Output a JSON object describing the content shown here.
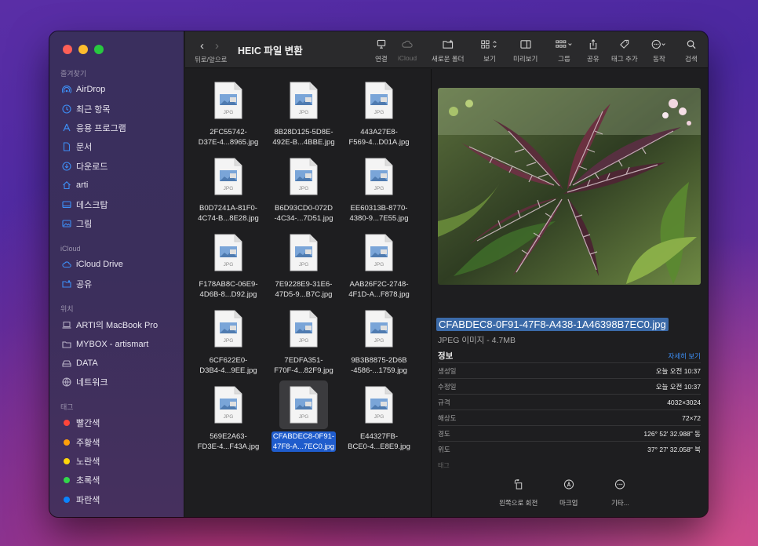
{
  "window": {
    "title": "HEIC 파일 변환",
    "back_label": "뒤로/앞으로"
  },
  "toolbar": {
    "buttons": [
      {
        "label": "연결",
        "icon": "monitor-icon"
      },
      {
        "label": "iCloud",
        "icon": "icloud-icon",
        "disabled": true
      },
      {
        "label": "새로운 폴더",
        "icon": "new-folder-icon"
      },
      {
        "label": "보기",
        "icon": "grid-view-icon"
      },
      {
        "label": "미리보기",
        "icon": "preview-pane-icon"
      },
      {
        "label": "그룹",
        "icon": "group-icon"
      },
      {
        "label": "공유",
        "icon": "share-icon"
      },
      {
        "label": "태그 추가",
        "icon": "tag-icon"
      },
      {
        "label": "동작",
        "icon": "action-icon"
      },
      {
        "label": "검색",
        "icon": "search-icon"
      }
    ]
  },
  "sidebar": {
    "favorites_heading": "즐겨찾기",
    "favorites": [
      {
        "label": "AirDrop",
        "icon": "airdrop-icon"
      },
      {
        "label": "최근 항목",
        "icon": "clock-icon"
      },
      {
        "label": "응용 프로그램",
        "icon": "applications-icon"
      },
      {
        "label": "문서",
        "icon": "document-icon"
      },
      {
        "label": "다운로드",
        "icon": "download-icon"
      },
      {
        "label": "arti",
        "icon": "home-icon"
      },
      {
        "label": "데스크탑",
        "icon": "desktop-icon"
      },
      {
        "label": "그림",
        "icon": "pictures-icon"
      }
    ],
    "icloud_heading": "iCloud",
    "icloud": [
      {
        "label": "iCloud Drive",
        "icon": "icloud-icon"
      },
      {
        "label": "공유",
        "icon": "shared-folder-icon"
      }
    ],
    "locations_heading": "위치",
    "locations": [
      {
        "label": "ARTI의 MacBook Pro",
        "icon": "laptop-icon"
      },
      {
        "label": "MYBOX - artismart",
        "icon": "folder-icon"
      },
      {
        "label": "DATA",
        "icon": "drive-icon"
      },
      {
        "label": "네트워크",
        "icon": "network-icon"
      }
    ],
    "tags_heading": "태그",
    "tags": [
      {
        "label": "빨간색",
        "color": "#ff453a"
      },
      {
        "label": "주황색",
        "color": "#ff9f0a"
      },
      {
        "label": "노란색",
        "color": "#ffd60a"
      },
      {
        "label": "초록색",
        "color": "#32d74b"
      },
      {
        "label": "파란색",
        "color": "#0a84ff"
      }
    ]
  },
  "files": [
    {
      "line1": "2FC55742-",
      "line2": "D37E-4...8965.jpg"
    },
    {
      "line1": "8B28D125-5D8E-",
      "line2": "492E-B...4BBE.jpg"
    },
    {
      "line1": "443A27E8-",
      "line2": "F569-4...D01A.jpg"
    },
    {
      "line1": "B0D7241A-81F0-",
      "line2": "4C74-B...8E28.jpg"
    },
    {
      "line1": "B6D93CD0-072D",
      "line2": "-4C34-...7D51.jpg"
    },
    {
      "line1": "EE60313B-8770-",
      "line2": "4380-9...7E55.jpg"
    },
    {
      "line1": "F178AB8C-06E9-",
      "line2": "4D6B-8...D92.jpg"
    },
    {
      "line1": "7E9228E9-31E6-",
      "line2": "47D5-9...B7C.jpg"
    },
    {
      "line1": "AAB26F2C-2748-",
      "line2": "4F1D-A...F878.jpg"
    },
    {
      "line1": "6CF622E0-",
      "line2": "D3B4-4...9EE.jpg"
    },
    {
      "line1": "7EDFA351-",
      "line2": "F70F-4...82F9.jpg"
    },
    {
      "line1": "9B3B8875-2D6B",
      "line2": "-4586-...1759.jpg"
    },
    {
      "line1": "569E2A63-",
      "line2": "FD3E-4...F43A.jpg"
    },
    {
      "line1": "CFABDEC8-0F91-",
      "line2": "47F8-A...7EC0.jpg",
      "selected": true
    },
    {
      "line1": "E44327FB-",
      "line2": "BCE0-4...E8E9.jpg"
    }
  ],
  "file_icon_label": "JPG",
  "preview": {
    "filename": "CFABDEC8-0F91-47F8-A438-1A46398B7EC0.jpg",
    "type": "JPEG 이미지 - 4.7MB",
    "info_heading": "정보",
    "more_link": "자세히 보기",
    "rows": [
      {
        "k": "생성일",
        "v": "오늘 오전 10:37"
      },
      {
        "k": "수정일",
        "v": "오늘 오전 10:37"
      },
      {
        "k": "규격",
        "v": "4032×3024"
      },
      {
        "k": "해상도",
        "v": "72×72"
      },
      {
        "k": "경도",
        "v": "126° 52' 32.988\" 동"
      },
      {
        "k": "위도",
        "v": "37° 27' 32.058\" 북"
      }
    ],
    "faded_label": "태그",
    "actions": [
      {
        "label": "왼쪽으로 회전",
        "icon": "rotate-left-icon"
      },
      {
        "label": "마크업",
        "icon": "markup-icon"
      },
      {
        "label": "기타...",
        "icon": "more-icon"
      }
    ]
  }
}
